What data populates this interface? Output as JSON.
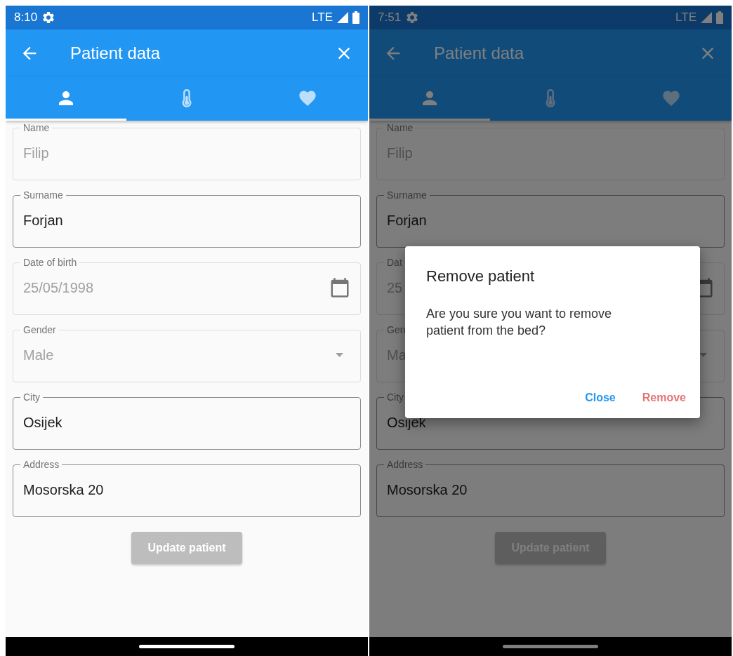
{
  "screens": [
    {
      "status_bar": {
        "time": "8:10",
        "network": "LTE"
      },
      "app_bar": {
        "title": "Patient data"
      },
      "tabs": [
        {
          "kind": "person",
          "selected": true
        },
        {
          "kind": "thermometer",
          "selected": false
        },
        {
          "kind": "heart",
          "selected": false
        }
      ],
      "fields": [
        {
          "kind": "text",
          "label": "Name",
          "value": "Filip",
          "disabled": true
        },
        {
          "kind": "text",
          "label": "Surname",
          "value": "Forjan",
          "disabled": false
        },
        {
          "kind": "date",
          "label": "Date of birth",
          "value": "25/05/1998",
          "disabled": true
        },
        {
          "kind": "dropdown",
          "label": "Gender",
          "value": "Male",
          "disabled": true
        },
        {
          "kind": "text",
          "label": "City",
          "value": "Osijek",
          "disabled": false
        },
        {
          "kind": "text",
          "label": "Address",
          "value": "Mosorska 20",
          "disabled": false
        }
      ],
      "button": {
        "label": "Update patient",
        "disabled": true
      }
    },
    {
      "status_bar": {
        "time": "7:51",
        "network": "LTE"
      },
      "app_bar": {
        "title": "Patient data"
      },
      "tabs": [
        {
          "kind": "person",
          "selected": true
        },
        {
          "kind": "thermometer",
          "selected": false
        },
        {
          "kind": "heart",
          "selected": false
        }
      ],
      "fields": [
        {
          "kind": "text",
          "label": "Name",
          "value": "Filip",
          "disabled": true
        },
        {
          "kind": "text",
          "label": "Surname",
          "value": "Forjan",
          "disabled": false
        },
        {
          "kind": "date",
          "label": "Dat",
          "value": "25",
          "disabled": true
        },
        {
          "kind": "dropdown",
          "label": "Gen",
          "value": "Ma",
          "disabled": true
        },
        {
          "kind": "text",
          "label": "City",
          "value": "Osijek",
          "disabled": false
        },
        {
          "kind": "text",
          "label": "Address",
          "value": "Mosorska 20",
          "disabled": false
        }
      ],
      "button": {
        "label": "Update patient",
        "disabled": true
      },
      "dialog": {
        "title": "Remove patient",
        "message": "Are you sure you want to remove patient from the bed?",
        "actions": [
          {
            "kind": "neutral",
            "label": "Close"
          },
          {
            "kind": "destructive",
            "label": "Remove"
          }
        ]
      }
    }
  ]
}
